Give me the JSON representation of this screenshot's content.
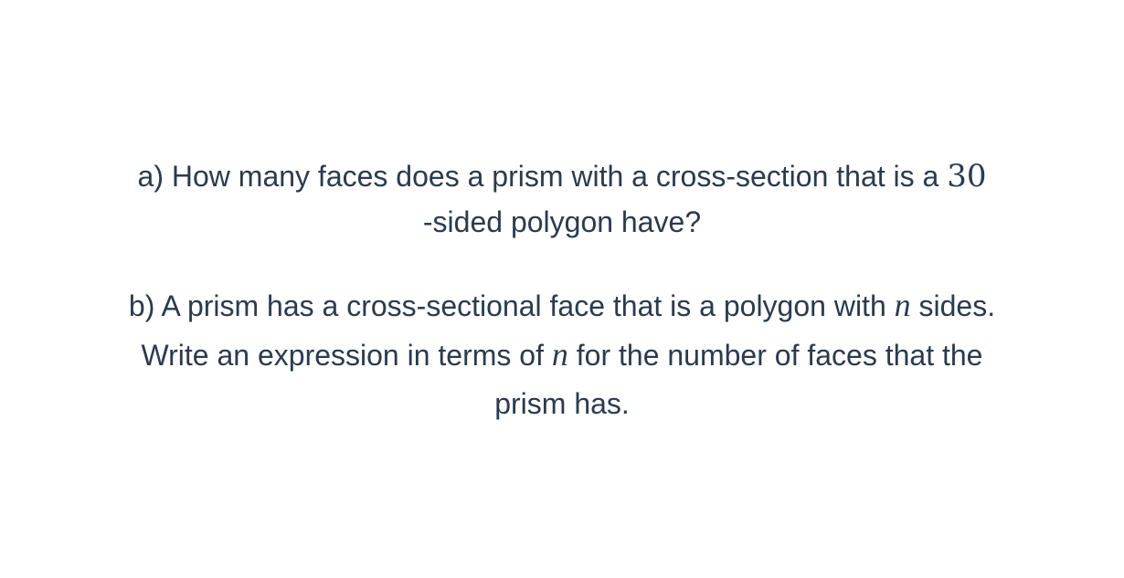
{
  "part_a": {
    "line1_text": "a) How many faces does a prism with a cross-section that is a ",
    "number": "30",
    "line2_text": "-sided polygon have?"
  },
  "part_b": {
    "line1_before": "b) A prism has a cross-sectional face that is a polygon with ",
    "variable_1": "n",
    "line1_after": " sides.",
    "line2_before": "Write an expression in terms of ",
    "variable_2": "n",
    "line2_after": " for the number of faces that the",
    "line3_text": "prism has."
  }
}
